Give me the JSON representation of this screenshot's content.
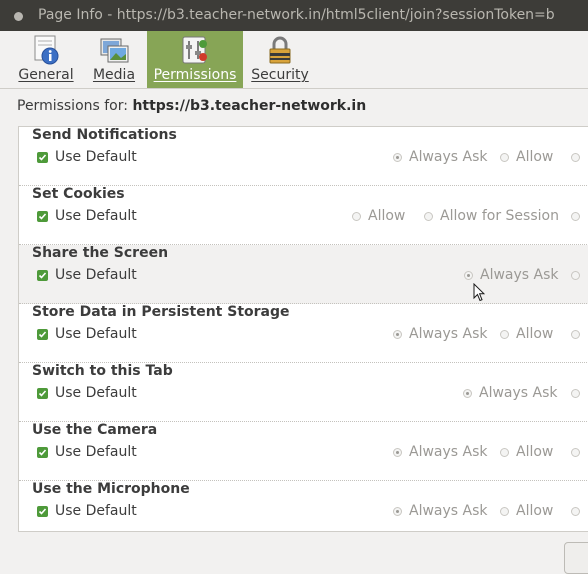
{
  "window": {
    "title": "Page Info - https://b3.teacher-network.in/html5client/join?sessionToken=b"
  },
  "tabs": [
    {
      "label": "General",
      "icon": "info-icon",
      "active": false
    },
    {
      "label": "Media",
      "icon": "media-icon",
      "active": false
    },
    {
      "label": "Permissions",
      "icon": "permissions-icon",
      "active": true
    },
    {
      "label": "Security",
      "icon": "lock-icon",
      "active": false
    }
  ],
  "permissions_for": {
    "label": "Permissions for:",
    "site": "https://b3.teacher-network.in"
  },
  "colors": {
    "accent": "#87a556",
    "checkbox": "#4e9a3a",
    "titlebar": "#3d3c38"
  },
  "permissions": [
    {
      "title": "Send Notifications",
      "use_default": "Use Default",
      "options": [
        {
          "label": "Always Ask",
          "selected": true
        },
        {
          "label": "Allow",
          "selected": false
        },
        {
          "label": "",
          "selected": false
        }
      ]
    },
    {
      "title": "Set Cookies",
      "use_default": "Use Default",
      "options": [
        {
          "label": "Allow",
          "selected": false
        },
        {
          "label": "Allow for Session",
          "selected": false
        },
        {
          "label": "",
          "selected": false
        }
      ]
    },
    {
      "title": "Share the Screen",
      "use_default": "Use Default",
      "options": [
        {
          "label": "Always Ask",
          "selected": true
        },
        {
          "label": "",
          "selected": false
        }
      ]
    },
    {
      "title": "Store Data in Persistent Storage",
      "use_default": "Use Default",
      "options": [
        {
          "label": "Always Ask",
          "selected": true
        },
        {
          "label": "Allow",
          "selected": false
        },
        {
          "label": "",
          "selected": false
        }
      ]
    },
    {
      "title": "Switch to this Tab",
      "use_default": "Use Default",
      "options": [
        {
          "label": "Always Ask",
          "selected": true
        },
        {
          "label": "",
          "selected": false
        }
      ]
    },
    {
      "title": "Use the Camera",
      "use_default": "Use Default",
      "options": [
        {
          "label": "Always Ask",
          "selected": true
        },
        {
          "label": "Allow",
          "selected": false
        },
        {
          "label": "",
          "selected": false
        }
      ]
    },
    {
      "title": "Use the Microphone",
      "use_default": "Use Default",
      "options": [
        {
          "label": "Always Ask",
          "selected": true
        },
        {
          "label": "Allow",
          "selected": false
        },
        {
          "label": "",
          "selected": false
        }
      ]
    }
  ]
}
